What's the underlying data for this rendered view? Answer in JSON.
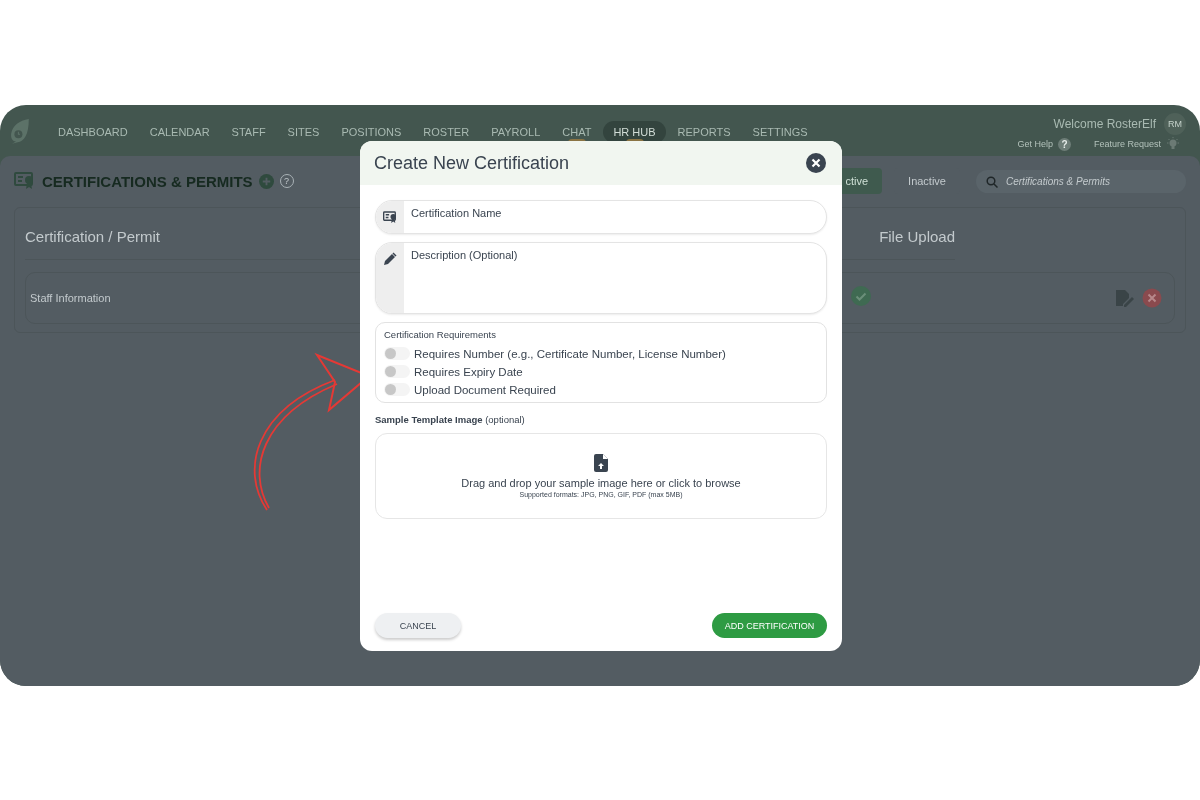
{
  "nav": {
    "items": [
      {
        "label": "DASHBOARD",
        "selected": false,
        "badge": false
      },
      {
        "label": "CALENDAR",
        "selected": false,
        "badge": false
      },
      {
        "label": "STAFF",
        "selected": false,
        "badge": false
      },
      {
        "label": "SITES",
        "selected": false,
        "badge": false
      },
      {
        "label": "POSITIONS",
        "selected": false,
        "badge": false
      },
      {
        "label": "ROSTER",
        "selected": false,
        "badge": false
      },
      {
        "label": "PAYROLL",
        "selected": false,
        "badge": false
      },
      {
        "label": "CHAT",
        "selected": false,
        "badge": true
      },
      {
        "label": "HR HUB",
        "selected": true,
        "badge": true
      },
      {
        "label": "REPORTS",
        "selected": false,
        "badge": false
      },
      {
        "label": "SETTINGS",
        "selected": false,
        "badge": false
      }
    ]
  },
  "user": {
    "welcome": "Welcome RosterElf",
    "avatar": "RM"
  },
  "help_links": [
    {
      "kind": "help",
      "label": "Get Help",
      "icon": "?"
    },
    {
      "kind": "idea",
      "label": "Feature Request"
    }
  ],
  "page": {
    "title": "CERTIFICATIONS & PERMITS",
    "help_icon": "?",
    "filter_tabs": [
      {
        "label": "ctive",
        "selected": true
      },
      {
        "label": "Inactive",
        "selected": false
      }
    ],
    "search": {
      "placeholder": "Certifications & Permits"
    },
    "table": {
      "columns": [
        "Certification / Permit",
        "File Upload"
      ],
      "rows": [
        {
          "name": "Staff Information",
          "file_upload": true
        }
      ]
    }
  },
  "dialog": {
    "title": "Create New Certification",
    "fields": [
      {
        "kind": "text",
        "placeholder": "Certification Name"
      },
      {
        "kind": "textarea",
        "placeholder": "Description (Optional)"
      }
    ],
    "requirements": {
      "title": "Certification Requirements",
      "options": [
        {
          "label": "Requires Number (e.g., Certificate Number, License Number)",
          "on": false
        },
        {
          "label": "Requires Expiry Date",
          "on": false
        },
        {
          "label": "Upload Document Required",
          "on": false
        }
      ]
    },
    "template": {
      "label": "**Sample Template Image** (optional)",
      "prompt": "Drag and drop your sample image here or click to browse",
      "formats": "Supported formats: JPG, PNG, GIF, PDF (max 5MB)"
    },
    "buttons": [
      {
        "kind": "cancel",
        "label": "CANCEL"
      },
      {
        "kind": "primary",
        "label": "ADD CERTIFICATION"
      }
    ]
  }
}
